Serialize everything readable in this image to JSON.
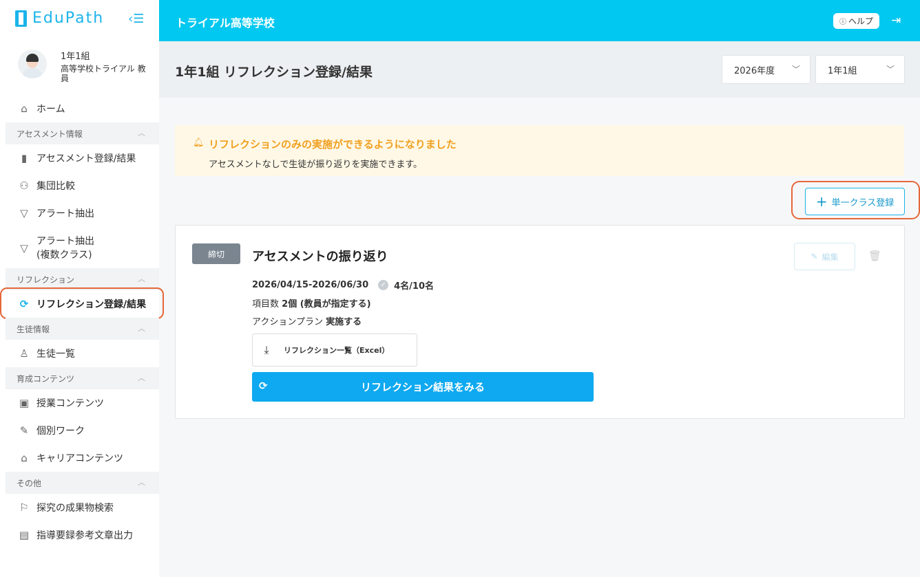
{
  "brand": {
    "name": "EduPath"
  },
  "profile": {
    "class": "1年1組",
    "school": "高等学校トライアル 教員"
  },
  "sidebar": {
    "home": "ホーム",
    "sections": {
      "assessment": "アセスメント情報",
      "reflection": "リフレクション",
      "student": "生徒情報",
      "content": "育成コンテンツ",
      "other": "その他"
    },
    "items": {
      "assessment_register": "アセスメント登録/結果",
      "group_compare": "集団比較",
      "alert_extract": "アラート抽出",
      "alert_extract_multi_1": "アラート抽出",
      "alert_extract_multi_2": "(複数クラス)",
      "reflection_register": "リフレクション登録/結果",
      "student_list": "生徒一覧",
      "lesson_content": "授業コンテンツ",
      "individual_work": "個別ワーク",
      "career_content": "キャリアコンテンツ",
      "inquiry_search": "探究の成果物検索",
      "guidance_output": "指導要録参考文章出力"
    }
  },
  "topbar": {
    "school_name": "トライアル高等学校",
    "help": "ヘルプ"
  },
  "header": {
    "title": "1年1組 リフレクション登録/結果",
    "year_select": "2026年度",
    "class_select": "1年1組"
  },
  "notice": {
    "title": "リフレクションのみの実施ができるようになりました",
    "body": "アセスメントなしで生徒が振り返りを実施できます。"
  },
  "register_button": "単一クラス登録",
  "card": {
    "badge": "締切",
    "title": "アセスメントの振り返り",
    "edit": "編集",
    "period": "2026/04/15-2026/06/30",
    "count": "4名/10名",
    "items_label": "項目数",
    "items_value": "2個 (教員が指定する)",
    "action_label": "アクションプラン",
    "action_value": "実施する",
    "download": "リフレクション一覧（Excel）",
    "result_button": "リフレクション結果をみる"
  },
  "colors": {
    "accent": "#00c8f0",
    "brand": "#1bb4ea",
    "warning": "#f0a020",
    "highlight": "#e5663a"
  }
}
